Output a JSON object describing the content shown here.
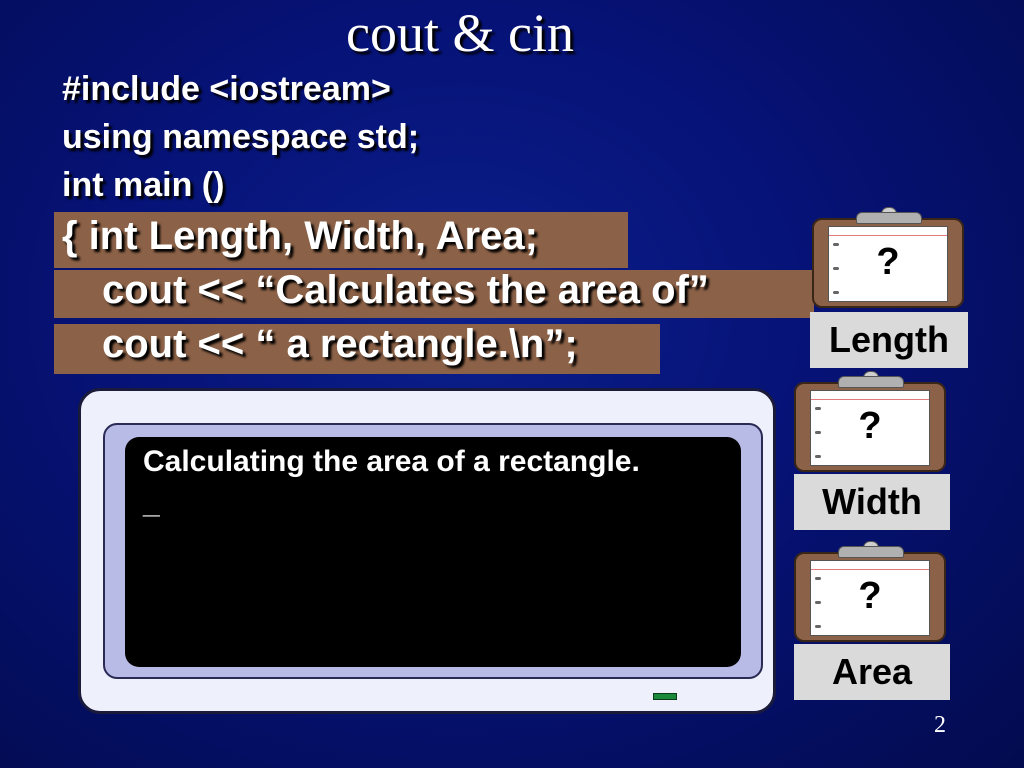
{
  "slide": {
    "title": "cout & cin",
    "page_number": "2"
  },
  "code": {
    "line1": "#include <iostream>",
    "line2": "using namespace std;",
    "line3": "int main ()",
    "highlight1": "{  int Length, Width, Area;",
    "highlight2": "cout << “Calculates the area of”",
    "highlight3": "cout << “ a rectangle.\\n”;"
  },
  "monitor": {
    "output_line": "Calculating the area of a rectangle.",
    "cursor": "_"
  },
  "variables": [
    {
      "value": "?",
      "label": "Length"
    },
    {
      "value": "?",
      "label": "Width"
    },
    {
      "value": "?",
      "label": "Area"
    }
  ],
  "colors": {
    "background": "#061276",
    "highlight_band": "#8b6147",
    "label_box": "#dadada"
  }
}
